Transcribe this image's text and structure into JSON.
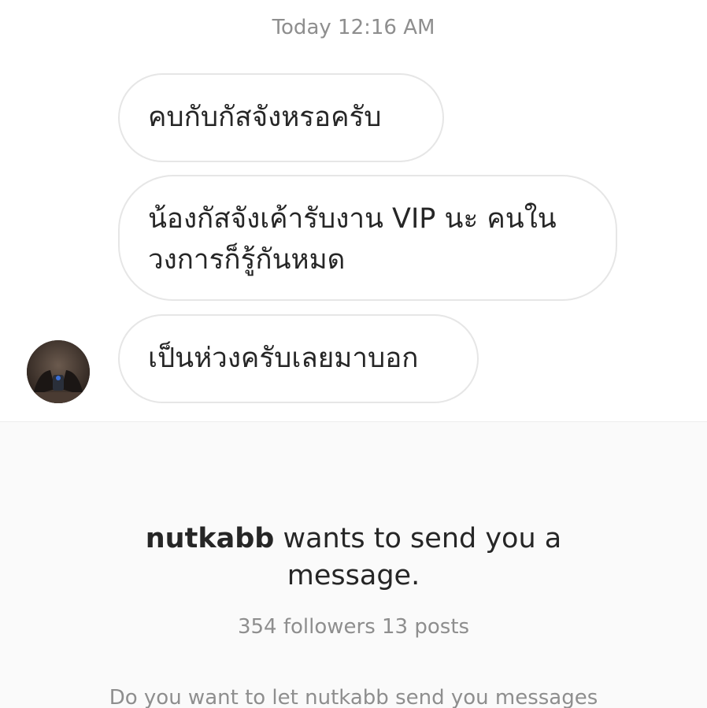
{
  "chat": {
    "timestamp": "Today 12:16 AM",
    "messages": [
      {
        "text": "คบกับกัสจังหรอครับ"
      },
      {
        "line1": "น้องกัสจังเค้ารับงาน VIP นะ คนใน",
        "line2": "วงการก็รู้กันหมด"
      },
      {
        "text": "เป็นห่วงครับเลยมาบอก"
      }
    ],
    "avatar_icon": "user-avatar-photo"
  },
  "request": {
    "username": "nutkabb",
    "title_rest": " wants to send you a message.",
    "followers": "354 followers",
    "posts": "13 posts",
    "question": "Do you want to let nutkabb send you messages"
  },
  "colors": {
    "bubble_border": "#e6e6e6",
    "text": "#262626",
    "muted": "#8e8e8e",
    "panel_bg": "#fafafa"
  }
}
